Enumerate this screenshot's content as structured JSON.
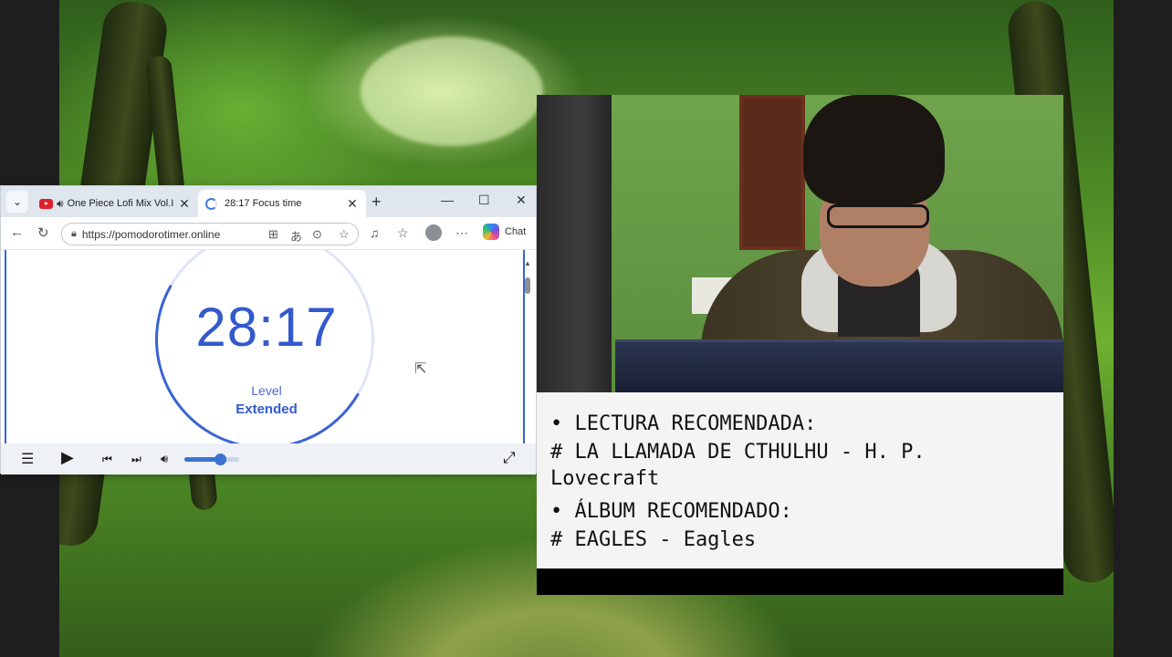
{
  "browser": {
    "tabs": [
      {
        "title": "One Piece Lofi Mix Vol.I",
        "playing": true
      },
      {
        "title": "28:17 Focus time",
        "active": true
      }
    ],
    "address": "https://pomodorotimer.online",
    "copilot_label": "Chat"
  },
  "timer": {
    "time": "28:17",
    "level_label": "Level",
    "level_value": "Extended"
  },
  "player": {
    "volume_percent": 65
  },
  "notes": {
    "line1": "• LECTURA RECOMENDADA:",
    "line2": "# LA LLAMADA DE CTHULHU - H. P.",
    "line3": "Lovecraft",
    "line4": "• ÁLBUM RECOMENDADO:",
    "line5": "# EAGLES - Eagles"
  },
  "colors": {
    "accent": "#3459cc",
    "youtube_red": "#e0202a"
  }
}
